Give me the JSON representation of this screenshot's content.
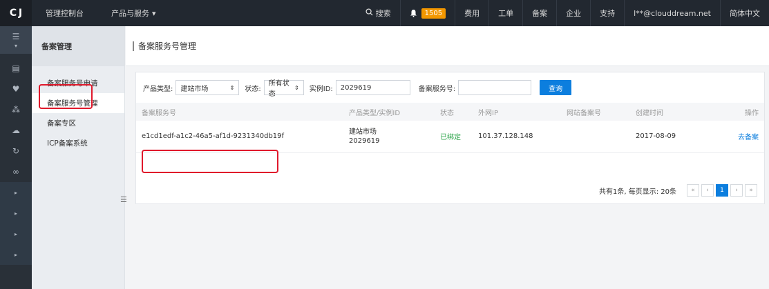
{
  "topbar": {
    "logo": "C J",
    "console": "管理控制台",
    "products": "产品与服务",
    "search": "搜索",
    "badge": "1505",
    "items": [
      "费用",
      "工单",
      "备案",
      "企业",
      "支持"
    ],
    "account": "l**@clouddream.net",
    "language": "简体中文"
  },
  "rail": {
    "icons": [
      "menu-icon",
      "list-icon",
      "shield-icon",
      "share-icon",
      "cloud-icon",
      "refresh-icon",
      "link-icon",
      "arrow-right-icon",
      "arrow-right-icon",
      "arrow-right-icon",
      "arrow-right-icon"
    ]
  },
  "sidenav": {
    "title": "备案管理",
    "items": [
      "备案服务号申请",
      "备案服务号管理",
      "备案专区",
      "ICP备案系统"
    ]
  },
  "page": {
    "title": "备案服务号管理"
  },
  "filters": {
    "product_type_label": "产品类型:",
    "product_type_value": "建站市场",
    "status_label": "状态:",
    "status_value": "所有状态",
    "instance_label": "实例ID:",
    "instance_value": "2029619",
    "service_no_label": "备案服务号:",
    "service_no_value": "",
    "query_button": "查询"
  },
  "table": {
    "headers": [
      "备案服务号",
      "产品类型/实例ID",
      "状态",
      "外网IP",
      "网站备案号",
      "创建时间",
      "操作"
    ],
    "rows": [
      {
        "service_no": "e1cd1edf-a1c2-46a5-af1d-9231340db19f",
        "product_type": "建站市场",
        "instance_id": "2029619",
        "status": "已绑定",
        "ip": "101.37.128.148",
        "site_no": "",
        "created": "2017-08-09",
        "action": "去备案"
      }
    ]
  },
  "pager": {
    "summary": "共有1条, 每页显示: 20条",
    "first": "«",
    "prev": "‹",
    "current": "1",
    "next": "›",
    "last": "»"
  },
  "colors": {
    "accent": "#0c7ede",
    "highlight": "#e0182b",
    "status_green": "#2ea54b",
    "badge": "#f39700"
  }
}
